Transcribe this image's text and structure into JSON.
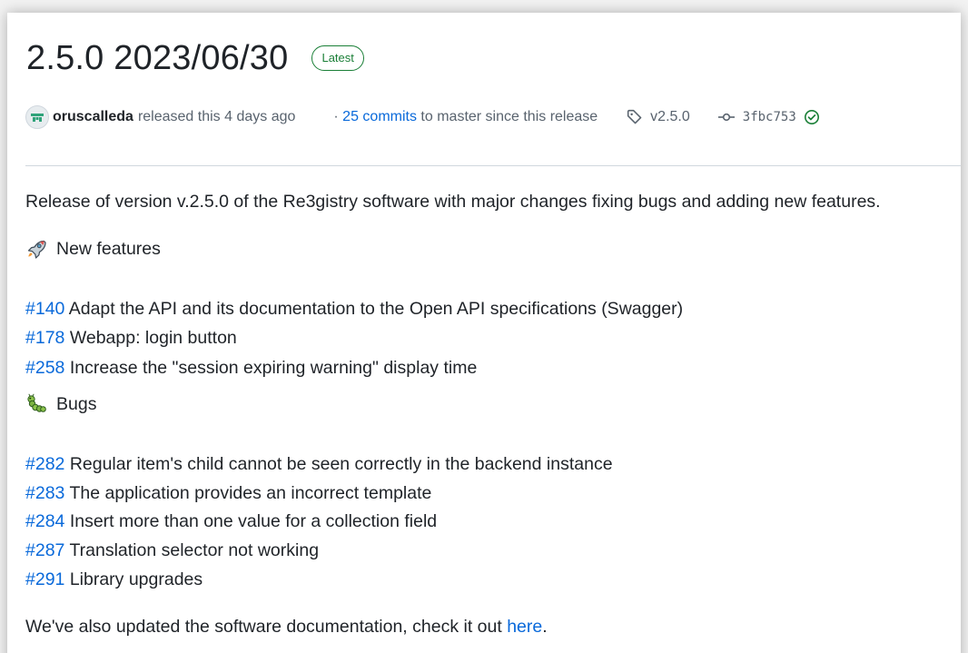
{
  "release": {
    "title": "2.5.0 2023/06/30",
    "badge": "Latest",
    "author": "oruscalleda",
    "released_text": "released this 4 days ago",
    "commits_prefix": "·",
    "commits_link": "25 commits",
    "commits_suffix": "to master since this release",
    "tag": "v2.5.0",
    "commit_sha": "3fbc753"
  },
  "body": {
    "intro": "Release of version v.2.5.0 of the Re3gistry software with major changes fixing bugs and adding new features.",
    "features_heading": "New features",
    "features": [
      {
        "issue": "#140",
        "text": "Adapt the API and its documentation to the Open API specifications (Swagger)"
      },
      {
        "issue": "#178",
        "text": "Webapp: login button"
      },
      {
        "issue": "#258",
        "text": "Increase the \"session expiring warning\" display time"
      }
    ],
    "bugs_heading": "Bugs",
    "bugs": [
      {
        "issue": "#282",
        "text": "Regular item's child cannot be seen correctly in the backend instance"
      },
      {
        "issue": "#283",
        "text": "The application provides an incorrect template"
      },
      {
        "issue": "#284",
        "text": "Insert more than one value for a collection field"
      },
      {
        "issue": "#287",
        "text": "Translation selector not working"
      },
      {
        "issue": "#291",
        "text": "Library upgrades"
      }
    ],
    "docs_prefix": "We've also updated the software documentation, check it out",
    "docs_link": "here",
    "docs_suffix": "."
  },
  "icons": {
    "features": "rocket-icon",
    "bugs": "caterpillar-icon",
    "tag": "tag-icon",
    "commit": "git-commit-icon",
    "verified": "check-circle-icon"
  },
  "colors": {
    "link": "#0969da",
    "badge": "#1a7f37",
    "muted": "#59636e"
  }
}
